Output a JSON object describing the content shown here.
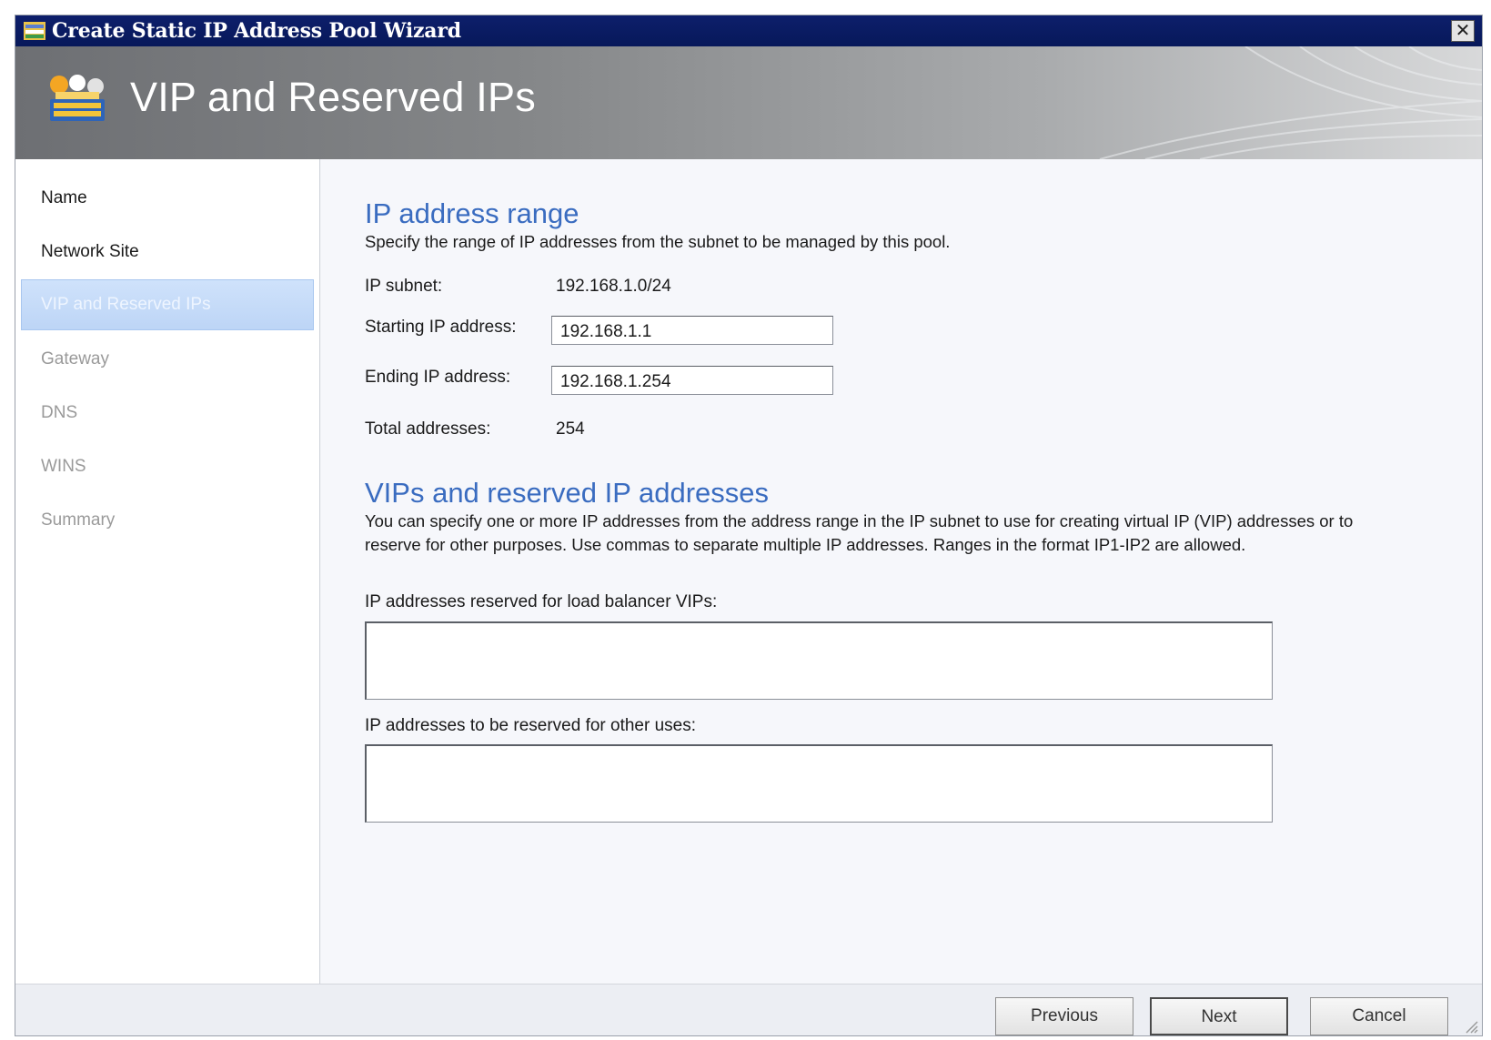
{
  "window": {
    "title": "Create Static IP Address Pool Wizard",
    "close_label": "✕"
  },
  "banner": {
    "title": "VIP and Reserved IPs"
  },
  "sidebar": {
    "items": [
      {
        "label": "Name",
        "state": "done"
      },
      {
        "label": "Network Site",
        "state": "done"
      },
      {
        "label": "VIP and Reserved IPs",
        "state": "selected"
      },
      {
        "label": "Gateway",
        "state": "disabled"
      },
      {
        "label": "DNS",
        "state": "disabled"
      },
      {
        "label": "WINS",
        "state": "disabled"
      },
      {
        "label": "Summary",
        "state": "disabled"
      }
    ]
  },
  "range": {
    "heading": "IP address range",
    "description": "Specify the range of IP addresses from the subnet to be managed by this pool.",
    "subnet_label": "IP subnet:",
    "subnet_value": "192.168.1.0/24",
    "start_label": "Starting IP address:",
    "start_value": "192.168.1.1",
    "end_label": "Ending IP address:",
    "end_value": "192.168.1.254",
    "total_label": "Total addresses:",
    "total_value": "254"
  },
  "vips": {
    "heading": "VIPs and reserved IP addresses",
    "description": "You can specify one or more IP addresses from the address range in the IP subnet to use for creating virtual IP (VIP) addresses or to reserve for other purposes. Use commas to separate multiple IP addresses. Ranges in the format IP1-IP2 are allowed.",
    "lb_label": "IP addresses reserved for load balancer VIPs:",
    "lb_value": "",
    "other_label": "IP addresses to be reserved for other uses:",
    "other_value": ""
  },
  "footer": {
    "previous": "Previous",
    "next": "Next",
    "cancel": "Cancel"
  }
}
